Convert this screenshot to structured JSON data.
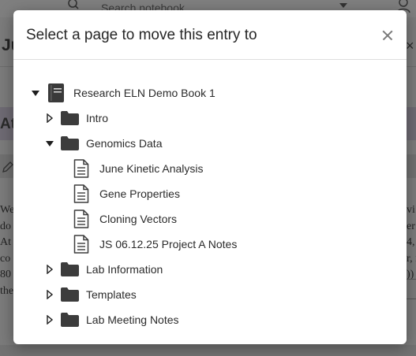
{
  "background": {
    "search_placeholder": "Search notebook",
    "page_title_partial": "Ju",
    "section_heading_partial": "At",
    "body_lines_left": [
      "We",
      "do",
      "At",
      "co",
      "80",
      "the"
    ],
    "body_lines_right": [
      "vi",
      "er",
      "4, /",
      "r, i",
      "))",
      ""
    ]
  },
  "modal": {
    "title": "Select a page to move this entry to",
    "close_label": "Close"
  },
  "tree": {
    "root": {
      "label": "Research ELN Demo Book 1",
      "icon": "notebook-icon",
      "expanded": true
    },
    "items": [
      {
        "label": "Intro",
        "type": "folder",
        "icon": "folder-icon",
        "expanded": false
      },
      {
        "label": "Genomics Data",
        "type": "folder",
        "icon": "folder-icon",
        "expanded": true,
        "pages": [
          {
            "label": "June Kinetic Analysis",
            "icon": "document-icon"
          },
          {
            "label": "Gene Properties",
            "icon": "document-icon"
          },
          {
            "label": "Cloning Vectors",
            "icon": "document-icon"
          },
          {
            "label": "JS 06.12.25 Project A Notes",
            "icon": "document-icon"
          }
        ]
      },
      {
        "label": "Lab Information",
        "type": "folder",
        "icon": "folder-icon",
        "expanded": false
      },
      {
        "label": "Templates",
        "type": "folder",
        "icon": "folder-icon",
        "expanded": false
      },
      {
        "label": "Lab Meeting Notes",
        "type": "folder",
        "icon": "folder-icon",
        "expanded": false
      }
    ]
  },
  "colors": {
    "overlay": "#7b7b7b",
    "modal_bg": "#ffffff",
    "icon_dark": "#3c3c3c",
    "text": "#2b2b2b"
  }
}
